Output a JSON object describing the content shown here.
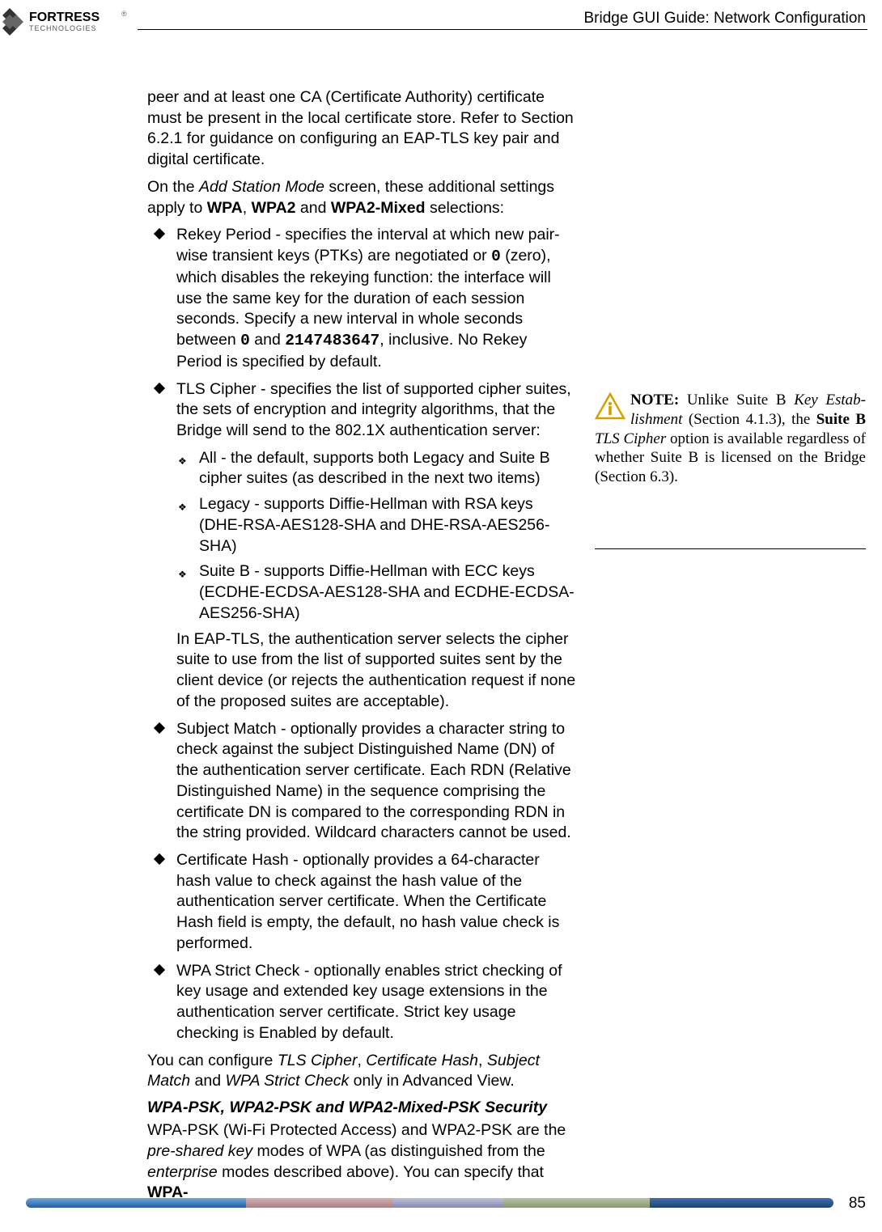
{
  "header": {
    "guide_title": "Bridge GUI Guide: Network Configuration",
    "logo_text_top": "FORTRESS",
    "logo_text_bottom": "TECHNOLOGIES"
  },
  "content": {
    "p1": "peer and at least one CA (Certificate Authority) certificate must be present in the local certificate store. Refer to Section 6.2.1 for guidance on configuring an EAP-TLS key pair and digital certificate.",
    "p2_a": "On the ",
    "p2_b": "Add Station Mode",
    "p2_c": " screen, these additional settings apply to ",
    "p2_d": "WPA",
    "p2_e": ", ",
    "p2_f": "WPA2",
    "p2_g": " and ",
    "p2_h": "WPA2-Mixed",
    "p2_i": " selections:",
    "b1_a": "Rekey Period",
    "b1_b": " - specifies the interval at which new pair-wise transient keys (PTKs) are negotiated or ",
    "b1_c": "0",
    "b1_d": " (zero), which disables the rekeying function: the interface will use the same key for the duration of each session seconds. Specify a new interval in whole seconds between ",
    "b1_e": "0",
    "b1_f": " and ",
    "b1_g": "2147483647",
    "b1_h": ", inclusive. No ",
    "b1_i": "Rekey Period",
    "b1_j": " is specified by default.",
    "b2_a": "TLS Cipher",
    "b2_b": " - specifies the list of supported cipher suites, the sets of encryption and integrity algorithms, that the Bridge will send to the 802.1X authentication server:",
    "sb1_a": "All",
    "sb1_b": " - the default, supports both ",
    "sb1_c": "Legacy",
    "sb1_d": " and ",
    "sb1_e": "Suite B",
    "sb1_f": " cipher suites (as described in the next two items)",
    "sb2_a": "Legacy",
    "sb2_b": " - supports Diffie-Hellman with RSA keys (DHE-RSA-AES128-SHA and DHE-RSA-AES256-SHA)",
    "sb3_a": "Suite B",
    "sb3_b": " - supports Diffie-Hellman with ECC keys (ECDHE-ECDSA-AES128-SHA and ECDHE-ECDSA-AES256-SHA)",
    "cont1": "In EAP-TLS, the authentication server selects the cipher suite to use from the list of supported suites sent by the client device (or rejects the authentication request if none of the proposed suites are acceptable).",
    "b3_a": "Subject Match",
    "b3_b": " - optionally provides a character string to check against the subject Distinguished Name (DN) of the authentication server certificate. Each RDN (Relative Distinguished Name) in the sequence comprising the certificate DN is compared to the corresponding RDN in the string provided. Wildcard characters cannot be used.",
    "b4_a": "Certificate Hash",
    "b4_b": " - optionally provides a 64-character hash value to check against the hash value of the authentication server certificate. When the ",
    "b4_c": "Certificate Hash",
    "b4_d": " field is empty, the default, no hash value check is performed.",
    "b5_a": "WPA Strict Check",
    "b5_b": " - optionally enables strict checking of key usage and extended key usage extensions in the authentication server certificate. Strict key usage checking is ",
    "b5_c": "Enabled",
    "b5_d": " by default.",
    "p3_a": "You can configure ",
    "p3_b": "TLS Cipher",
    "p3_c": ", ",
    "p3_d": "Certificate Hash",
    "p3_e": ", ",
    "p3_f": "Subject Match",
    "p3_g": " and ",
    "p3_h": "WPA Strict Check",
    "p3_i": " only in Advanced View.",
    "subheading": "WPA-PSK, WPA2-PSK and WPA2-Mixed-PSK Security",
    "p4_a": "WPA-PSK (Wi-Fi Protected Access) and WPA2-PSK are the ",
    "p4_b": "pre-shared key",
    "p4_c": " modes of WPA (as distinguished from the ",
    "p4_d": "enterprise",
    "p4_e": " modes described above). You can specify that ",
    "p4_f": "WPA-"
  },
  "sidebar": {
    "note_label": "NOTE:",
    "t1": " Unlike Suite B ",
    "t2": "Key Estab­lishment",
    "t3": " (Section 4.1.3), the ",
    "t4": "Suite B",
    "t5": " ",
    "t6": "TLS Cipher",
    "t7": " option is available re­gardless of whether Suite B is licensed on the Bridge (Section 6.3)."
  },
  "footer": {
    "page_number": "85"
  }
}
